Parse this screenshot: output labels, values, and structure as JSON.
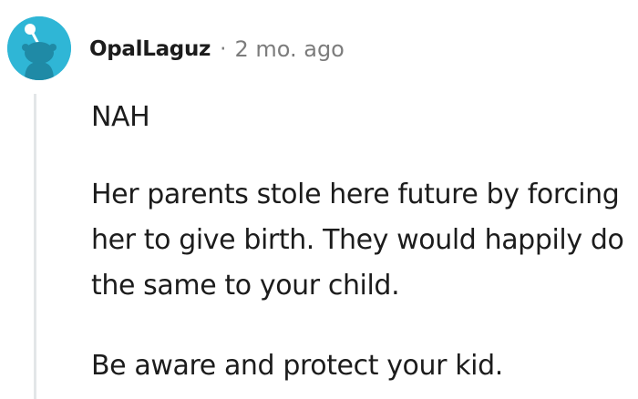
{
  "comment": {
    "avatar": {
      "icon": "snoo-avatar-icon",
      "background": "#2fb6d6"
    },
    "author": "OpalLaguz",
    "separator": "·",
    "timestamp": "2 mo. ago",
    "paragraphs": [
      "NAH",
      "Her parents stole here future by forcing her to give birth. They would happily do the same to your child.",
      "Be aware and protect your kid."
    ]
  }
}
